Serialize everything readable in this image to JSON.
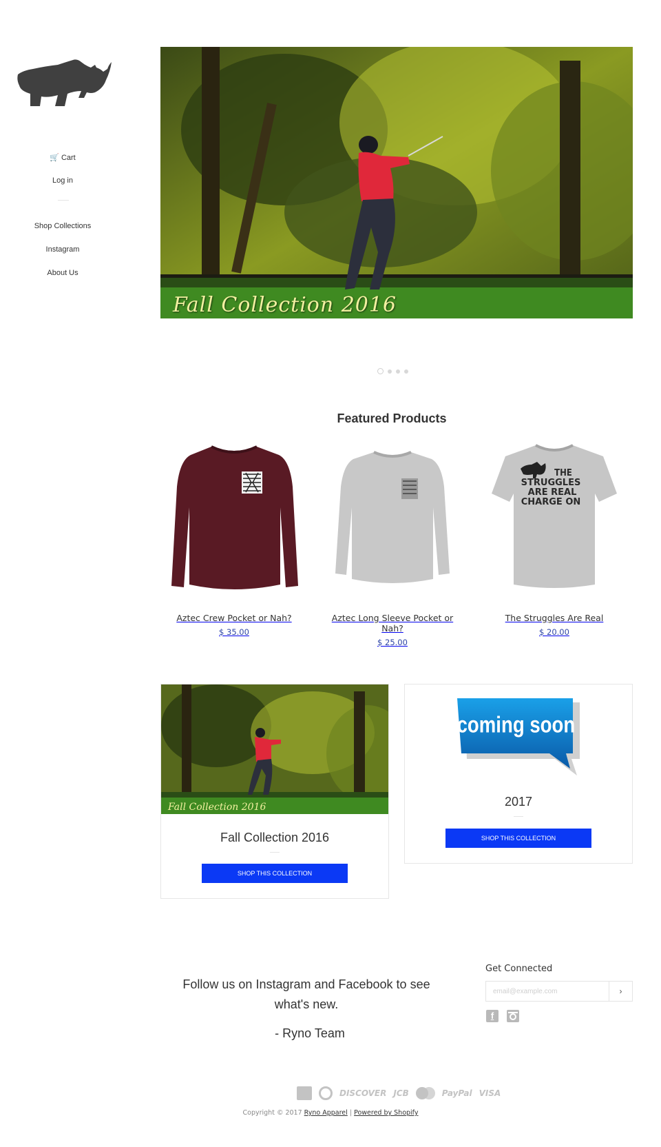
{
  "sidebar": {
    "logo_alt": "Ryno Apparel",
    "cart_label": "Cart",
    "login_label": "Log in",
    "nav": [
      {
        "label": "Shop Collections"
      },
      {
        "label": "Instagram"
      },
      {
        "label": "About Us"
      }
    ]
  },
  "hero": {
    "caption": "Fall Collection 2016",
    "slide_count": 4,
    "active_slide": 1
  },
  "featured": {
    "title": "Featured Products",
    "products": [
      {
        "name": "Aztec Crew Pocket or Nah?",
        "price": "$ 35.00",
        "image": "maroon-crewneck-sweatshirt"
      },
      {
        "name": "Aztec Long Sleeve Pocket or Nah?",
        "price": "$ 25.00",
        "image": "grey-long-sleeve-shirt"
      },
      {
        "name": "The Struggles Are Real",
        "price": "$ 20.00",
        "image": "grey-tshirt-struggles"
      }
    ]
  },
  "collections": [
    {
      "title": "Fall Collection 2016",
      "image_caption": "Fall Collection 2016",
      "button": "SHOP THIS COLLECTION"
    },
    {
      "title": "2017",
      "image_text": "coming soon",
      "button": "SHOP THIS COLLECTION"
    }
  ],
  "footer": {
    "follow_text": "Follow us on Instagram and Facebook to see what's new.",
    "signature": "- Ryno Team",
    "get_connected": "Get Connected",
    "email_placeholder": "email@example.com",
    "submit_glyph": "›",
    "payment_text": [
      "DISCOVER",
      "JCB",
      "PayPal",
      "VISA"
    ],
    "copyright": "Copyright © 2017",
    "store_name": "Ryno Apparel",
    "powered": "Powered by Shopify"
  },
  "colors": {
    "accent": "#0b39f5",
    "price": "#2e45a5",
    "text": "#333333"
  }
}
